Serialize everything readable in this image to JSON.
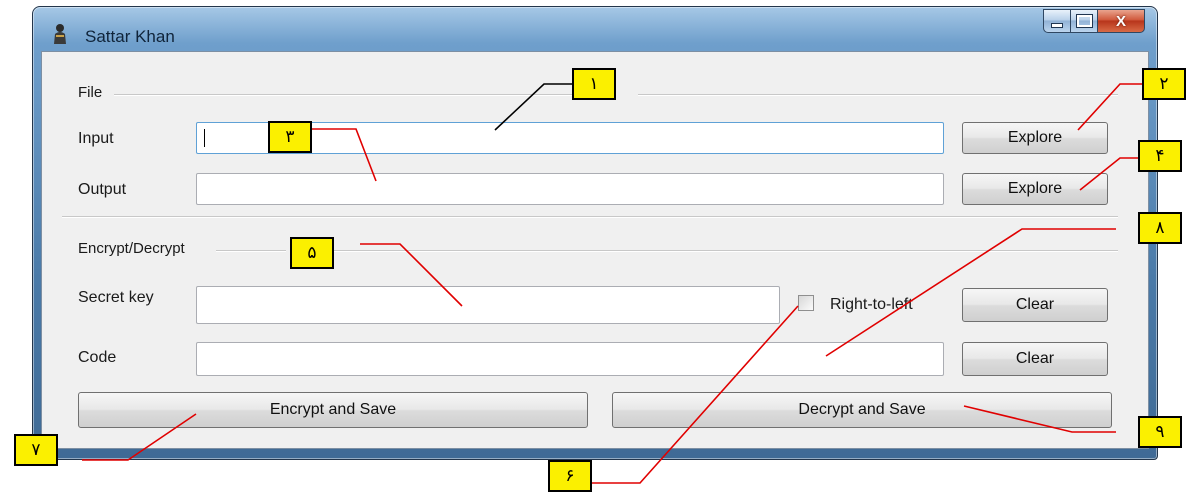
{
  "window": {
    "title": "Sattar Khan",
    "icon": "knight-figure-icon",
    "controls": {
      "minimize": "minimize-icon",
      "maximize": "maximize-icon",
      "close_glyph": "X"
    }
  },
  "file_section": {
    "title": "File",
    "input_label": "Input",
    "input_value": "",
    "output_label": "Output",
    "output_value": "",
    "explore_input": "Explore",
    "explore_output": "Explore"
  },
  "crypto_section": {
    "title": "Encrypt/Decrypt",
    "secret_key_label": "Secret key",
    "secret_key_value": "",
    "rtl_label": "Right-to-left",
    "rtl_checked": false,
    "clear_secret": "Clear",
    "code_label": "Code",
    "code_value": "",
    "clear_code": "Clear"
  },
  "actions": {
    "encrypt": "Encrypt and Save",
    "decrypt": "Decrypt and Save"
  },
  "callouts": {
    "c1": "١",
    "c2": "٢",
    "c3": "٣",
    "c4": "۴",
    "c5": "۵",
    "c6": "۶",
    "c7": "٧",
    "c8": "٨",
    "c9": "٩"
  },
  "colors": {
    "callout_fill": "#fbf000",
    "callout_line_black": "#000000",
    "callout_line_red": "#e00000",
    "window_frame": "#4a7aa8",
    "client_bg": "#f0f0f0"
  }
}
